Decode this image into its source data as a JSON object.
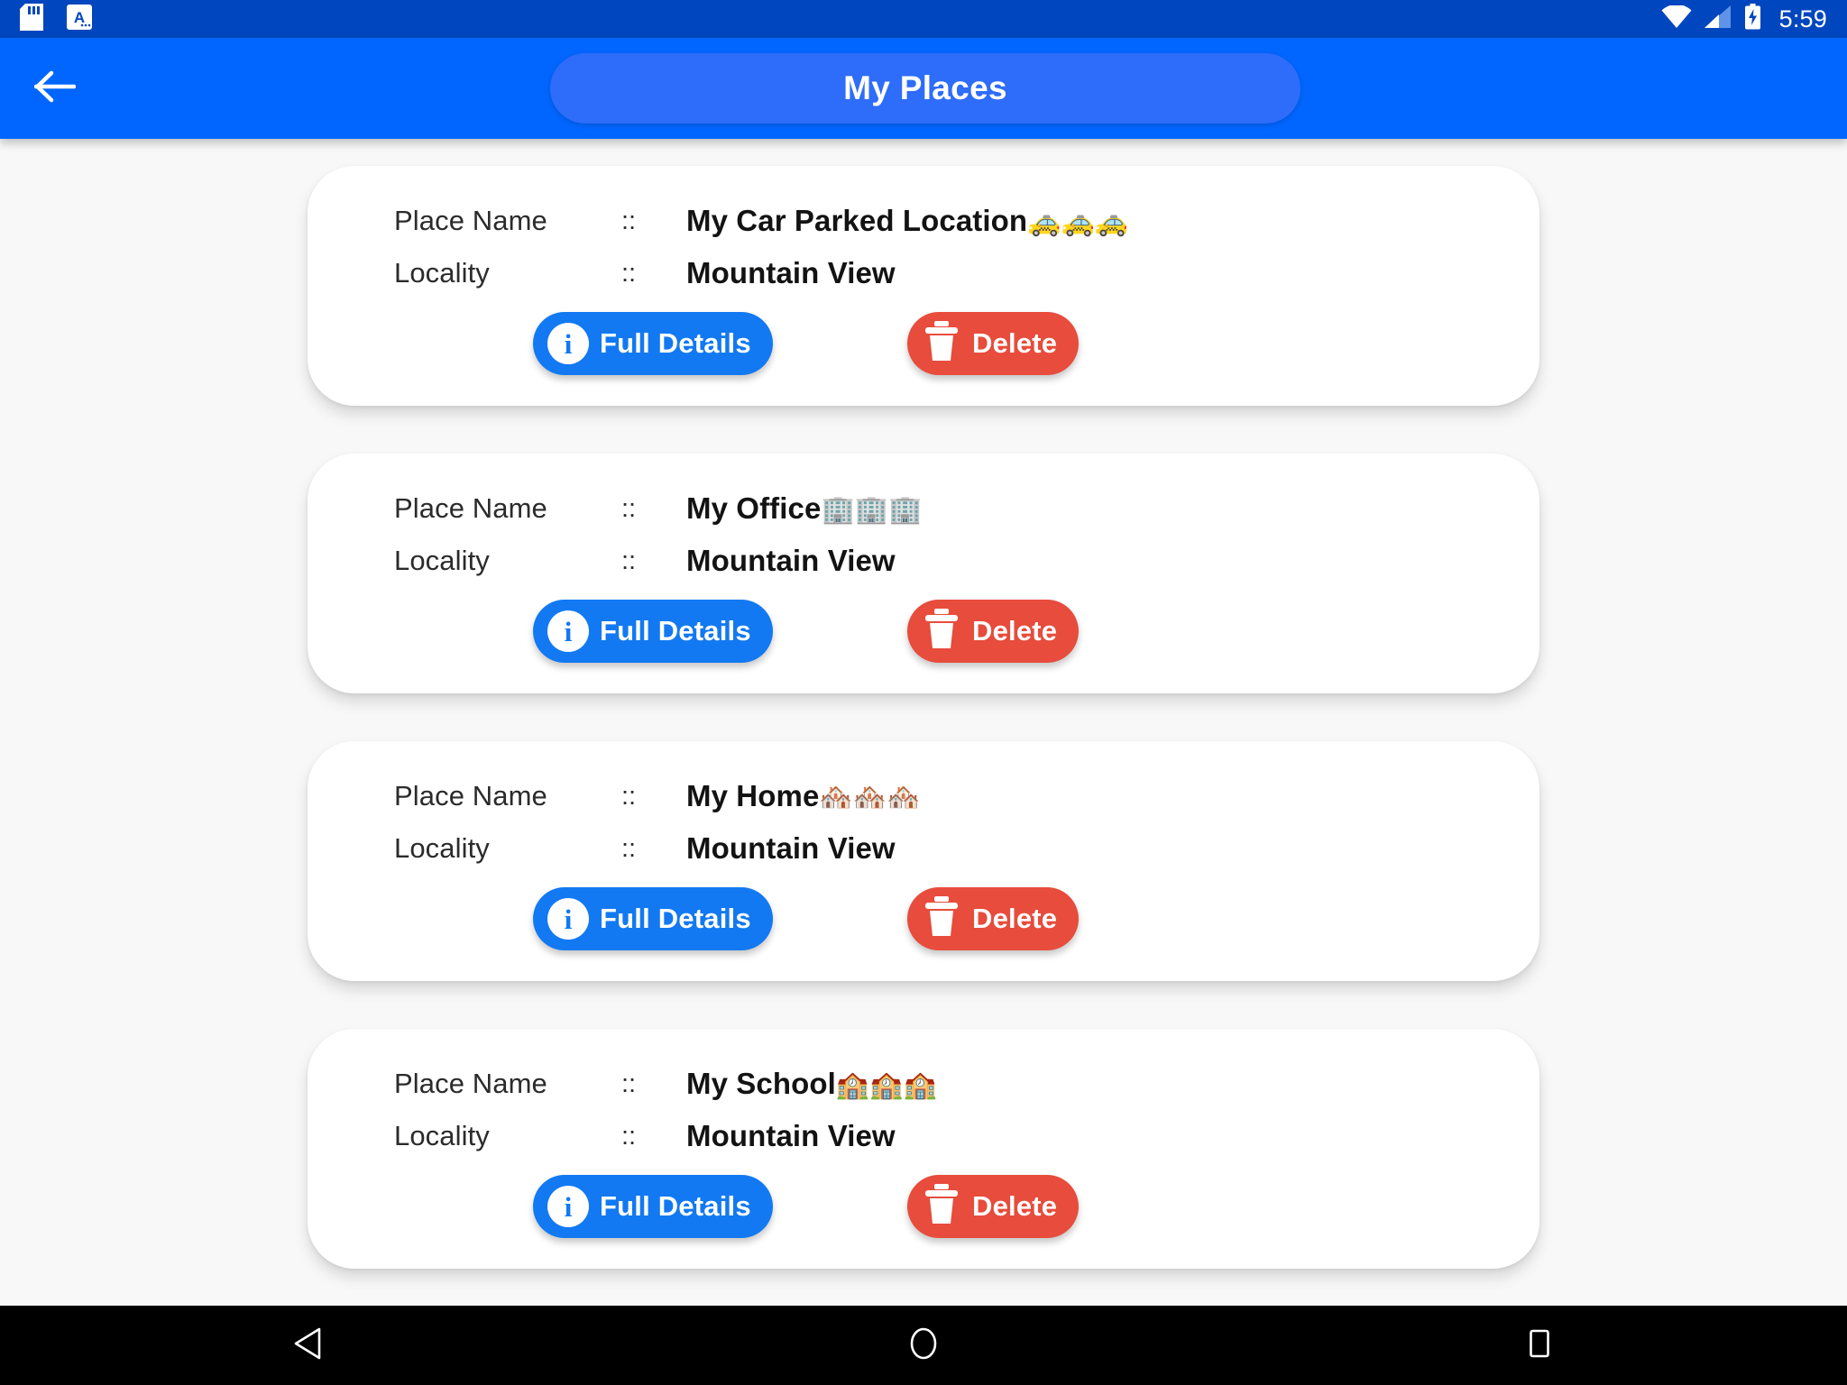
{
  "status_bar": {
    "background_color": "#0046BE",
    "time": "5:59",
    "left_icons": [
      "sd-card-icon",
      "android-beam-icon"
    ],
    "right_icons": [
      "wifi-icon",
      "cellular-signal-icon",
      "battery-charging-icon"
    ]
  },
  "app_bar": {
    "background_color": "#0066FF",
    "pill_color": "#2E6CFA",
    "back_icon": "arrow-back-icon",
    "title": "My Places"
  },
  "labels": {
    "place_name": "Place Name",
    "locality": "Locality",
    "separator": "::"
  },
  "buttons": {
    "details_label": "Full Details",
    "details_icon": "info-icon",
    "details_color": "#1279F2",
    "delete_label": "Delete",
    "delete_icon": "trash-icon",
    "delete_color": "#E74C3C"
  },
  "places": [
    {
      "place_name": "My Car Parked Location",
      "emoji": "🚕🚕🚕",
      "locality": "Mountain View"
    },
    {
      "place_name": "My Office",
      "emoji": "🏢🏢🏢",
      "locality": "Mountain View"
    },
    {
      "place_name": "My Home",
      "emoji": "🏘️🏘️🏘️",
      "locality": "Mountain View"
    },
    {
      "place_name": "My School",
      "emoji": "🏫🏫🏫",
      "locality": "Mountain View"
    }
  ],
  "nav_bar": {
    "background_color": "#000000",
    "items": [
      "back-triangle-icon",
      "home-circle-icon",
      "recents-square-icon"
    ]
  }
}
